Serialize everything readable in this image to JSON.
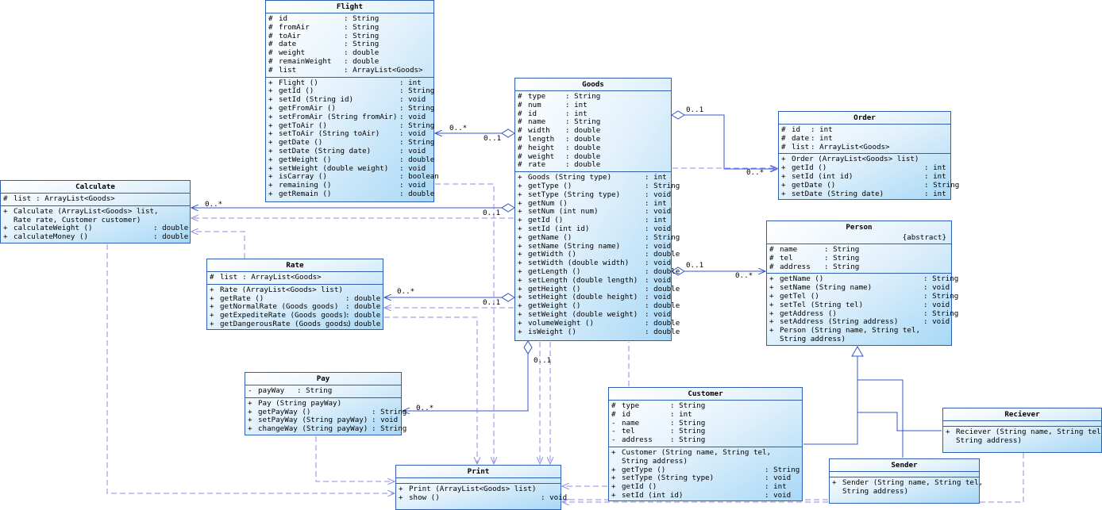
{
  "classes": {
    "flight": {
      "name": "Flight",
      "attributes": [
        {
          "vis": "#",
          "name": "id",
          "type": "String"
        },
        {
          "vis": "#",
          "name": "fromAir",
          "type": "String"
        },
        {
          "vis": "#",
          "name": "toAir",
          "type": "String"
        },
        {
          "vis": "#",
          "name": "date",
          "type": "String"
        },
        {
          "vis": "#",
          "name": "weight",
          "type": "double"
        },
        {
          "vis": "#",
          "name": "remainWeight",
          "type": "double"
        },
        {
          "vis": "#",
          "name": "list",
          "type": "ArrayList<Goods>"
        }
      ],
      "operations": [
        {
          "vis": "+",
          "name": "Flight ()",
          "type": "int"
        },
        {
          "vis": "+",
          "name": "getId ()",
          "type": "String"
        },
        {
          "vis": "+",
          "name": "setId (String id)",
          "type": "void"
        },
        {
          "vis": "+",
          "name": "getFromAir ()",
          "type": "String"
        },
        {
          "vis": "+",
          "name": "setFromAir (String fromAir)",
          "type": "void"
        },
        {
          "vis": "+",
          "name": "getToAir ()",
          "type": "String"
        },
        {
          "vis": "+",
          "name": "setToAir (String toAir)",
          "type": "void"
        },
        {
          "vis": "+",
          "name": "getDate ()",
          "type": "String"
        },
        {
          "vis": "+",
          "name": "setDate (String date)",
          "type": "void"
        },
        {
          "vis": "+",
          "name": "getWeight ()",
          "type": "double"
        },
        {
          "vis": "+",
          "name": "setWeight (double weight)",
          "type": "void"
        },
        {
          "vis": "+",
          "name": "isCarray ()",
          "type": "boolean"
        },
        {
          "vis": "+",
          "name": "remaining ()",
          "type": "void"
        },
        {
          "vis": "+",
          "name": "getRemain ()",
          "type": "double"
        }
      ]
    },
    "goods": {
      "name": "Goods",
      "attributes": [
        {
          "vis": "#",
          "name": "type",
          "type": "String"
        },
        {
          "vis": "#",
          "name": "num",
          "type": "int"
        },
        {
          "vis": "#",
          "name": "id",
          "type": "int"
        },
        {
          "vis": "#",
          "name": "name",
          "type": "String"
        },
        {
          "vis": "#",
          "name": "width",
          "type": "double"
        },
        {
          "vis": "#",
          "name": "length",
          "type": "double"
        },
        {
          "vis": "#",
          "name": "height",
          "type": "double"
        },
        {
          "vis": "#",
          "name": "weight",
          "type": "double"
        },
        {
          "vis": "#",
          "name": "rate",
          "type": "double"
        }
      ],
      "operations": [
        {
          "vis": "+",
          "name": "Goods (String type)",
          "type": "int"
        },
        {
          "vis": "+",
          "name": "getType ()",
          "type": "String"
        },
        {
          "vis": "+",
          "name": "setType (String type)",
          "type": "void"
        },
        {
          "vis": "+",
          "name": "getNum ()",
          "type": "int"
        },
        {
          "vis": "+",
          "name": "setNum (int num)",
          "type": "void"
        },
        {
          "vis": "+",
          "name": "getId ()",
          "type": "int"
        },
        {
          "vis": "+",
          "name": "setId (int id)",
          "type": "void"
        },
        {
          "vis": "+",
          "name": "getName ()",
          "type": "String"
        },
        {
          "vis": "+",
          "name": "setName (String name)",
          "type": "void"
        },
        {
          "vis": "+",
          "name": "getWidth ()",
          "type": "double"
        },
        {
          "vis": "+",
          "name": "setWidth (double width)",
          "type": "void"
        },
        {
          "vis": "+",
          "name": "getLength ()",
          "type": "double"
        },
        {
          "vis": "+",
          "name": "setLength (double length)",
          "type": "void"
        },
        {
          "vis": "+",
          "name": "getHeight ()",
          "type": "double"
        },
        {
          "vis": "+",
          "name": "setHeight (double height)",
          "type": "void"
        },
        {
          "vis": "+",
          "name": "getWeight ()",
          "type": "double"
        },
        {
          "vis": "+",
          "name": "setWeight (double weight)",
          "type": "void"
        },
        {
          "vis": "+",
          "name": "volumeWeight ()",
          "type": "double"
        },
        {
          "vis": "+",
          "name": "isWeight ()",
          "type": "double"
        }
      ]
    },
    "order": {
      "name": "Order",
      "attributes": [
        {
          "vis": "#",
          "name": "id",
          "type": "int"
        },
        {
          "vis": "#",
          "name": "date",
          "type": "int"
        },
        {
          "vis": "#",
          "name": "list",
          "type": "ArrayList<Goods>"
        }
      ],
      "operations": [
        {
          "vis": "+",
          "name": "Order (ArrayList<Goods> list)",
          "type": ""
        },
        {
          "vis": "+",
          "name": "getId ()",
          "type": "int"
        },
        {
          "vis": "+",
          "name": "setId (int id)",
          "type": "int"
        },
        {
          "vis": "+",
          "name": "getDate ()",
          "type": "String"
        },
        {
          "vis": "+",
          "name": "setDate (String date)",
          "type": "int"
        }
      ]
    },
    "calculate": {
      "name": "Calculate",
      "attributes": [
        {
          "vis": "#",
          "name": "list",
          "type": "ArrayList<Goods>"
        }
      ],
      "operations": [
        {
          "vis": "+",
          "name": "Calculate (ArrayList<Goods> list,",
          "type": "",
          "cont": "Rate rate, Customer customer)"
        },
        {
          "vis": "+",
          "name": "calculateWeight ()",
          "type": "double"
        },
        {
          "vis": "+",
          "name": "calculateMoney ()",
          "type": "double"
        }
      ]
    },
    "rate": {
      "name": "Rate",
      "attributes": [
        {
          "vis": "#",
          "name": "list",
          "type": "ArrayList<Goods>"
        }
      ],
      "operations": [
        {
          "vis": "+",
          "name": "Rate (ArrayList<Goods> list)",
          "type": ""
        },
        {
          "vis": "+",
          "name": "getRate ()",
          "type": "double"
        },
        {
          "vis": "+",
          "name": "getNormalRate (Goods goods)",
          "type": "double"
        },
        {
          "vis": "+",
          "name": "getExpediteRate (Goods goods)",
          "type": "double"
        },
        {
          "vis": "+",
          "name": "getDangerousRate (Goods goods)",
          "type": "double"
        }
      ]
    },
    "person": {
      "name": "Person",
      "stereotype": "{abstract}",
      "attributes": [
        {
          "vis": "#",
          "name": "name",
          "type": "String"
        },
        {
          "vis": "#",
          "name": "tel",
          "type": "String"
        },
        {
          "vis": "#",
          "name": "address",
          "type": "String"
        }
      ],
      "operations": [
        {
          "vis": "+",
          "name": "getName ()",
          "type": "String"
        },
        {
          "vis": "+",
          "name": "setName (String name)",
          "type": "void"
        },
        {
          "vis": "+",
          "name": "getTel ()",
          "type": "String"
        },
        {
          "vis": "+",
          "name": "setTel (String tel)",
          "type": "void"
        },
        {
          "vis": "+",
          "name": "getAddress ()",
          "type": "String"
        },
        {
          "vis": "+",
          "name": "setAddress (String address)",
          "type": "void"
        },
        {
          "vis": "+",
          "name": "Person (String name, String tel,",
          "type": "",
          "cont": "String address)"
        }
      ]
    },
    "pay": {
      "name": "Pay",
      "attributes": [
        {
          "vis": "-",
          "name": "payWay",
          "type": "String"
        }
      ],
      "operations": [
        {
          "vis": "+",
          "name": "Pay (String payWay)",
          "type": ""
        },
        {
          "vis": "+",
          "name": "getPayWay ()",
          "type": "String"
        },
        {
          "vis": "+",
          "name": "setPayWay (String payWay)",
          "type": "void"
        },
        {
          "vis": "+",
          "name": "changeWay (String payWay)",
          "type": "String"
        }
      ]
    },
    "customer": {
      "name": "Customer",
      "attributes": [
        {
          "vis": "#",
          "name": "type",
          "type": "String"
        },
        {
          "vis": "#",
          "name": "id",
          "type": "int"
        },
        {
          "vis": "-",
          "name": "name",
          "type": "String"
        },
        {
          "vis": "-",
          "name": "tel",
          "type": "String"
        },
        {
          "vis": "-",
          "name": "address",
          "type": "String"
        }
      ],
      "operations": [
        {
          "vis": "+",
          "name": "Customer (String name, String tel,",
          "type": "",
          "cont": "String address)"
        },
        {
          "vis": "+",
          "name": "getType ()",
          "type": "String"
        },
        {
          "vis": "+",
          "name": "setType (String type)",
          "type": "void"
        },
        {
          "vis": "+",
          "name": "getId ()",
          "type": "int"
        },
        {
          "vis": "+",
          "name": "setId (int id)",
          "type": "void"
        }
      ]
    },
    "reciever": {
      "name": "Reciever",
      "attributes": [],
      "operations": [
        {
          "vis": "+",
          "name": "Reciever (String name, String tel,",
          "type": "",
          "cont": "String address)"
        }
      ]
    },
    "sender": {
      "name": "Sender",
      "attributes": [],
      "operations": [
        {
          "vis": "+",
          "name": "Sender (String name, String tel,",
          "type": "",
          "cont": "String address)"
        }
      ]
    },
    "print": {
      "name": "Print",
      "attributes": [],
      "operations": [
        {
          "vis": "+",
          "name": "Print (ArrayList<Goods> list)",
          "type": ""
        },
        {
          "vis": "+",
          "name": "show ()",
          "type": "void"
        }
      ]
    }
  },
  "multiplicities": {
    "goods_flight_near_flight": "0..*",
    "goods_flight_near_goods": "0..1",
    "goods_order_near_goods": "0..1",
    "goods_order_near_order": "0..*",
    "goods_calculate_near_calc": "0..*",
    "goods_calculate_near_goods": "0..1",
    "goods_rate_near_rate": "0..*",
    "goods_rate_near_goods": "0..1",
    "goods_person_near_goods": "0..1",
    "goods_person_near_person": "0..*",
    "goods_pay_near_goods": "0..1",
    "goods_pay_near_pay": "0..*"
  },
  "colors": {
    "border": "#2f5fb0",
    "line": "#3355cc",
    "dashed": "#8b8fe0",
    "fill_light": "#ffffff",
    "fill_dark": "#a8d8f6"
  }
}
